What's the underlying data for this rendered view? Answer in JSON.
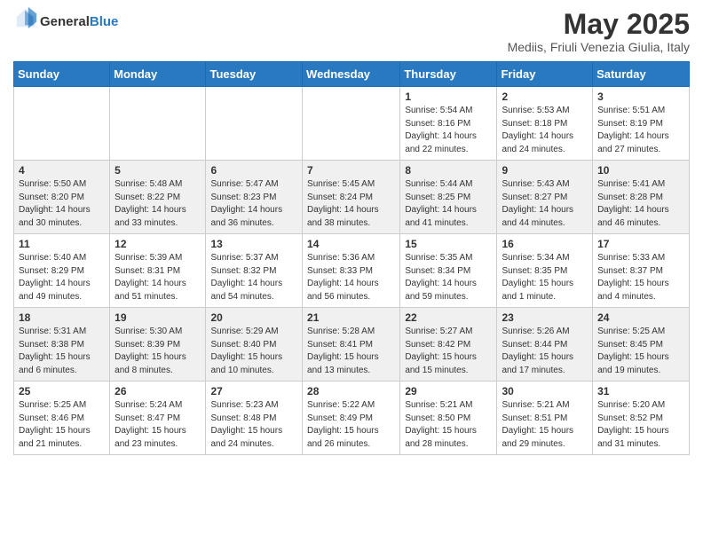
{
  "logo": {
    "general": "General",
    "blue": "Blue"
  },
  "title": "May 2025",
  "subtitle": "Mediis, Friuli Venezia Giulia, Italy",
  "days_of_week": [
    "Sunday",
    "Monday",
    "Tuesday",
    "Wednesday",
    "Thursday",
    "Friday",
    "Saturday"
  ],
  "weeks": [
    [
      {
        "day": "",
        "info": ""
      },
      {
        "day": "",
        "info": ""
      },
      {
        "day": "",
        "info": ""
      },
      {
        "day": "",
        "info": ""
      },
      {
        "day": "1",
        "info": "Sunrise: 5:54 AM\nSunset: 8:16 PM\nDaylight: 14 hours\nand 22 minutes."
      },
      {
        "day": "2",
        "info": "Sunrise: 5:53 AM\nSunset: 8:18 PM\nDaylight: 14 hours\nand 24 minutes."
      },
      {
        "day": "3",
        "info": "Sunrise: 5:51 AM\nSunset: 8:19 PM\nDaylight: 14 hours\nand 27 minutes."
      }
    ],
    [
      {
        "day": "4",
        "info": "Sunrise: 5:50 AM\nSunset: 8:20 PM\nDaylight: 14 hours\nand 30 minutes."
      },
      {
        "day": "5",
        "info": "Sunrise: 5:48 AM\nSunset: 8:22 PM\nDaylight: 14 hours\nand 33 minutes."
      },
      {
        "day": "6",
        "info": "Sunrise: 5:47 AM\nSunset: 8:23 PM\nDaylight: 14 hours\nand 36 minutes."
      },
      {
        "day": "7",
        "info": "Sunrise: 5:45 AM\nSunset: 8:24 PM\nDaylight: 14 hours\nand 38 minutes."
      },
      {
        "day": "8",
        "info": "Sunrise: 5:44 AM\nSunset: 8:25 PM\nDaylight: 14 hours\nand 41 minutes."
      },
      {
        "day": "9",
        "info": "Sunrise: 5:43 AM\nSunset: 8:27 PM\nDaylight: 14 hours\nand 44 minutes."
      },
      {
        "day": "10",
        "info": "Sunrise: 5:41 AM\nSunset: 8:28 PM\nDaylight: 14 hours\nand 46 minutes."
      }
    ],
    [
      {
        "day": "11",
        "info": "Sunrise: 5:40 AM\nSunset: 8:29 PM\nDaylight: 14 hours\nand 49 minutes."
      },
      {
        "day": "12",
        "info": "Sunrise: 5:39 AM\nSunset: 8:31 PM\nDaylight: 14 hours\nand 51 minutes."
      },
      {
        "day": "13",
        "info": "Sunrise: 5:37 AM\nSunset: 8:32 PM\nDaylight: 14 hours\nand 54 minutes."
      },
      {
        "day": "14",
        "info": "Sunrise: 5:36 AM\nSunset: 8:33 PM\nDaylight: 14 hours\nand 56 minutes."
      },
      {
        "day": "15",
        "info": "Sunrise: 5:35 AM\nSunset: 8:34 PM\nDaylight: 14 hours\nand 59 minutes."
      },
      {
        "day": "16",
        "info": "Sunrise: 5:34 AM\nSunset: 8:35 PM\nDaylight: 15 hours\nand 1 minute."
      },
      {
        "day": "17",
        "info": "Sunrise: 5:33 AM\nSunset: 8:37 PM\nDaylight: 15 hours\nand 4 minutes."
      }
    ],
    [
      {
        "day": "18",
        "info": "Sunrise: 5:31 AM\nSunset: 8:38 PM\nDaylight: 15 hours\nand 6 minutes."
      },
      {
        "day": "19",
        "info": "Sunrise: 5:30 AM\nSunset: 8:39 PM\nDaylight: 15 hours\nand 8 minutes."
      },
      {
        "day": "20",
        "info": "Sunrise: 5:29 AM\nSunset: 8:40 PM\nDaylight: 15 hours\nand 10 minutes."
      },
      {
        "day": "21",
        "info": "Sunrise: 5:28 AM\nSunset: 8:41 PM\nDaylight: 15 hours\nand 13 minutes."
      },
      {
        "day": "22",
        "info": "Sunrise: 5:27 AM\nSunset: 8:42 PM\nDaylight: 15 hours\nand 15 minutes."
      },
      {
        "day": "23",
        "info": "Sunrise: 5:26 AM\nSunset: 8:44 PM\nDaylight: 15 hours\nand 17 minutes."
      },
      {
        "day": "24",
        "info": "Sunrise: 5:25 AM\nSunset: 8:45 PM\nDaylight: 15 hours\nand 19 minutes."
      }
    ],
    [
      {
        "day": "25",
        "info": "Sunrise: 5:25 AM\nSunset: 8:46 PM\nDaylight: 15 hours\nand 21 minutes."
      },
      {
        "day": "26",
        "info": "Sunrise: 5:24 AM\nSunset: 8:47 PM\nDaylight: 15 hours\nand 23 minutes."
      },
      {
        "day": "27",
        "info": "Sunrise: 5:23 AM\nSunset: 8:48 PM\nDaylight: 15 hours\nand 24 minutes."
      },
      {
        "day": "28",
        "info": "Sunrise: 5:22 AM\nSunset: 8:49 PM\nDaylight: 15 hours\nand 26 minutes."
      },
      {
        "day": "29",
        "info": "Sunrise: 5:21 AM\nSunset: 8:50 PM\nDaylight: 15 hours\nand 28 minutes."
      },
      {
        "day": "30",
        "info": "Sunrise: 5:21 AM\nSunset: 8:51 PM\nDaylight: 15 hours\nand 29 minutes."
      },
      {
        "day": "31",
        "info": "Sunrise: 5:20 AM\nSunset: 8:52 PM\nDaylight: 15 hours\nand 31 minutes."
      }
    ]
  ]
}
